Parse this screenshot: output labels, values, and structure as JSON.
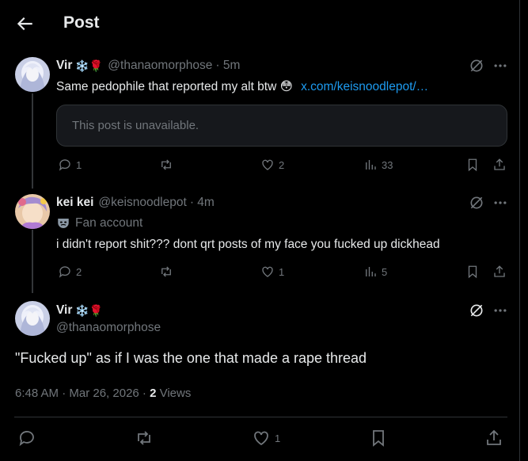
{
  "header": {
    "title": "Post"
  },
  "posts": [
    {
      "name": "Vir",
      "emojis": "❄️🌹",
      "handle": "@thanaomorphose",
      "time": "· 5m",
      "text": "Same pedophile that reported my alt btw 😳",
      "link": "x.com/keisnoodlepot/…",
      "quoted": "This post is unavailable.",
      "replies": "1",
      "reposts": "",
      "likes": "2",
      "views": "33"
    },
    {
      "name": "kei kei",
      "handle": "@keisnoodlepot",
      "time": "· 4m",
      "label": "Fan account",
      "text": "i didn't report shit??? dont qrt posts of my face you fucked up dickhead",
      "replies": "2",
      "reposts": "",
      "likes": "1",
      "views": "5"
    }
  ],
  "main_post": {
    "name": "Vir",
    "emojis": "❄️🌹",
    "handle": "@thanaomorphose",
    "text": "\"Fucked up\" as if I was the one that made a rape thread",
    "time": "6:48 AM · Mar 26, 2026 · ",
    "views_count": "2",
    "views_label": "Views",
    "likes": "1"
  },
  "colors": {
    "accent": "#1d9bf0",
    "muted": "#71767b",
    "text": "#e7e9ea",
    "background": "#000000"
  },
  "icons": [
    "back-arrow-icon",
    "grok-icon",
    "more-icon",
    "reply-icon",
    "repost-icon",
    "like-icon",
    "views-icon",
    "bookmark-icon",
    "share-icon",
    "mask-icon"
  ]
}
